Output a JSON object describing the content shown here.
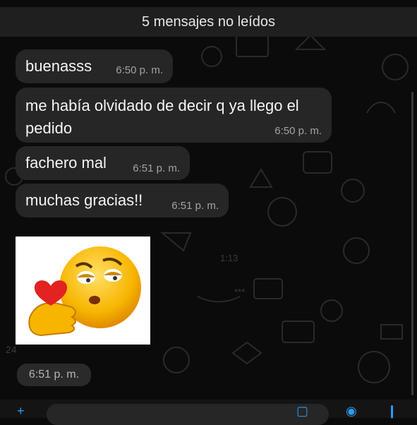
{
  "unread_banner": "5 mensajes no leídos",
  "messages": [
    {
      "text": "buenasss",
      "time": "6:50 p. m."
    },
    {
      "text": "me había olvidado de decir q ya llego el pedido",
      "time": "6:50 p. m."
    },
    {
      "text": "fachero mal",
      "time": "6:51 p. m."
    },
    {
      "text": "muchas gracias!!",
      "time": "6:51 p. m."
    }
  ],
  "sticker": {
    "description_icon": "kissing-emoji-sticker",
    "time": "6:51 p. m."
  },
  "doodle_text": {
    "clock": "1:13",
    "stars": "***",
    "number": "24"
  },
  "composer": {
    "add_icon": "plus-icon",
    "camera_icon": "camera-icon",
    "mic_icon": "mic-icon",
    "sticker_icon": "sticker-icon"
  },
  "colors": {
    "background": "#0b0b0b",
    "bubble": "#262626",
    "accent": "#2f9bf0"
  }
}
